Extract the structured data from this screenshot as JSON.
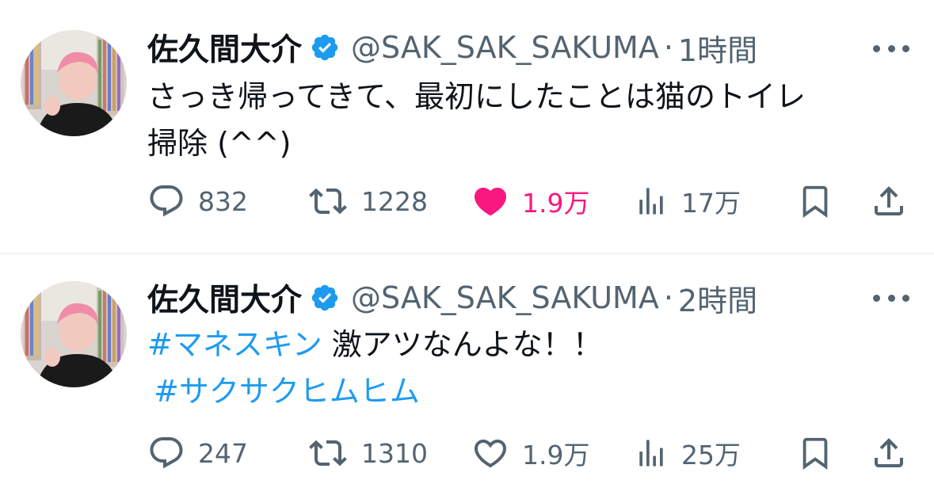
{
  "colors": {
    "text": "#0f1419",
    "secondary": "#536471",
    "link": "#1d9bf0",
    "like_active": "#f91880",
    "verified": "#1d9bf0",
    "divider": "#eff3f4"
  },
  "tweets": [
    {
      "author": {
        "display_name": "佐久間大介",
        "handle": "@SAK_SAK_SAKUMA",
        "verified_icon": "verified-badge-icon"
      },
      "separator": "·",
      "time": "1時間",
      "text_lines": [
        "さっき帰ってきて、最初にしたことは猫のトイレ",
        "掃除 (^^)"
      ],
      "stats": {
        "replies": "832",
        "retweets": "1228",
        "likes": "1.9万",
        "views": "17万"
      },
      "liked": true
    },
    {
      "author": {
        "display_name": "佐久間大介",
        "handle": "@SAK_SAK_SAKUMA",
        "verified_icon": "verified-badge-icon"
      },
      "separator": "·",
      "time": "2時間",
      "hashtag_1": "#マネスキン",
      "text_after_hashtag_1": " 激アツなんよな！！",
      "hashtag_2": "#サクサクヒムヒム",
      "stats": {
        "replies": "247",
        "retweets": "1310",
        "likes": "1.9万",
        "views": "25万"
      },
      "liked": false
    }
  ]
}
